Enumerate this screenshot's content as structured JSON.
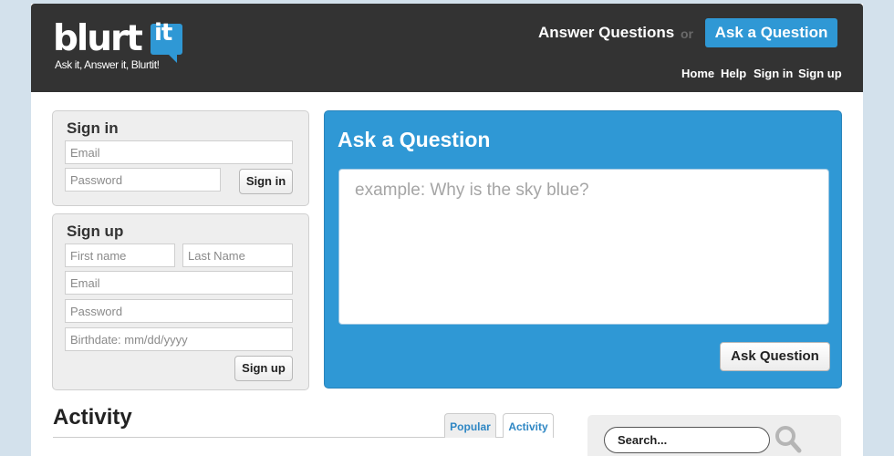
{
  "brand": {
    "logo_word": "blurt",
    "logo_it": "it",
    "tagline": "Ask it, Answer it, Blurtit!"
  },
  "header": {
    "answer_link": "Answer Questions",
    "or_text": "or",
    "ask_button": "Ask a Question",
    "nav": [
      "Home",
      "Help",
      "Sign in",
      "Sign up"
    ]
  },
  "sign_in": {
    "title": "Sign in",
    "email_placeholder": "Email",
    "password_placeholder": "Password",
    "button": "Sign in"
  },
  "sign_up": {
    "title": "Sign up",
    "first_name_placeholder": "First name",
    "last_name_placeholder": "Last Name",
    "email_placeholder": "Email",
    "password_placeholder": "Password",
    "birthdate_placeholder": "Birthdate: mm/dd/yyyy",
    "button": "Sign up"
  },
  "ask": {
    "title": "Ask a Question",
    "placeholder": "example: Why is the sky blue?",
    "submit": "Ask Question"
  },
  "activity": {
    "title": "Activity",
    "tabs": [
      "Popular",
      "Activity"
    ]
  },
  "search": {
    "placeholder": "Search..."
  },
  "colors": {
    "accent": "#2f98d5",
    "header_bg": "#333333",
    "page_bg": "#d3e1ec",
    "panel_bg": "#eeeeee"
  }
}
